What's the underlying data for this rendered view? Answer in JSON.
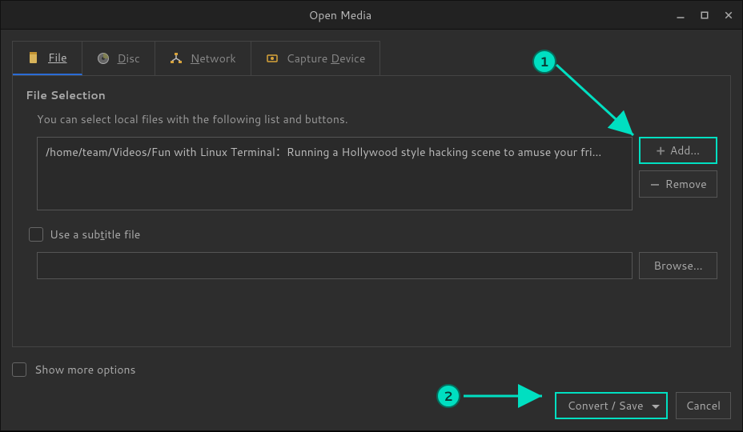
{
  "window": {
    "title": "Open Media"
  },
  "tabs": {
    "file": "File",
    "disc": "Disc",
    "network": "Network",
    "capture": "Capture Device"
  },
  "file_selection": {
    "title": "File Selection",
    "help": "You can select local files with the following list and buttons.",
    "items": [
      "/home/team/Videos/Fun with Linux Terminal：Running a Hollywood style hacking scene to amuse your fri…"
    ],
    "add_label": "Add…",
    "remove_label": "Remove"
  },
  "subtitle": {
    "checkbox_pre": "Use a sub",
    "checkbox_u": "t",
    "checkbox_post": "itle file",
    "browse_label": "Browse…"
  },
  "footer": {
    "show_more": "Show more options",
    "convert_label": "Convert / Save",
    "cancel_label": "Cancel"
  },
  "annotations": {
    "badge1": "1",
    "badge2": "2"
  }
}
